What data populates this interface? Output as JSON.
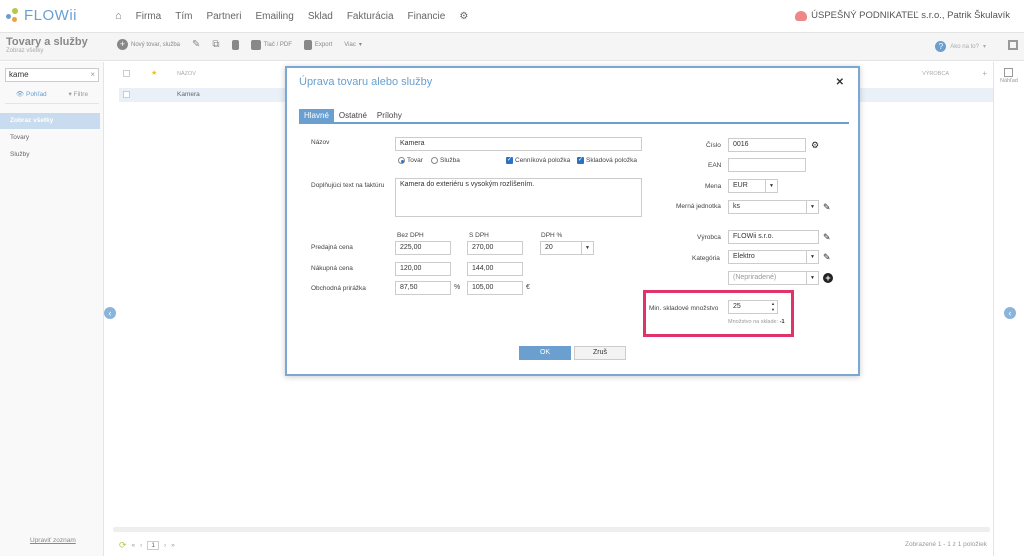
{
  "topnav": {
    "logo": "FLOWii",
    "items": [
      "Firma",
      "Tím",
      "Partneri",
      "Emailing",
      "Sklad",
      "Fakturácia",
      "Financie"
    ],
    "company": "ÚSPEŠNÝ PODNIKATEĽ s.r.o., Patrik Škulavík"
  },
  "subheader": {
    "title": "Tovary a služby",
    "subtitle": "Zobraz všetky",
    "toolbar": {
      "new": "Nový tovar, služba",
      "print": "Tlač / PDF",
      "export": "Export",
      "more": "Viac"
    },
    "help": "Ako na to?"
  },
  "sidebar": {
    "search_value": "kame",
    "tab_view": "Pohľad",
    "tab_filter": "Filtre",
    "items": [
      "Zobraz všetky",
      "Tovary",
      "Služby"
    ],
    "footer": "Upraviť zoznam"
  },
  "list": {
    "col_name": "NÁZOV",
    "col_vyrobca": "VÝROBCA",
    "rows": [
      "Kamera"
    ]
  },
  "right_strip": {
    "label": "Náhľad"
  },
  "footer": {
    "page": "1",
    "info": "Zobrazené 1 - 1 z 1 položiek"
  },
  "dialog": {
    "title": "Úprava tovaru alebo služby",
    "tabs": [
      "Hlavné",
      "Ostatné",
      "Prílohy"
    ],
    "labels": {
      "nazov": "Názov",
      "doplnujuci": "Doplňujúci text na faktúru",
      "bez_dph": "Bez DPH",
      "s_dph": "S DPH",
      "dph_pct": "DPH %",
      "predajna": "Predajná cena",
      "nakupna": "Nákupná cena",
      "prirazka": "Obchodná prirážka",
      "cislo": "Číslo",
      "ean": "EAN",
      "mena": "Mena",
      "merna": "Merná jednotka",
      "vyrobca": "Výrobca",
      "kategoria": "Kategória",
      "min_sklad": "Min. skladové množstvo",
      "mnozstvo_note": "Množstvo na sklade: ",
      "mnozstvo_value": "-1"
    },
    "values": {
      "nazov": "Kamera",
      "doplnujuci": "Kamera do exteriéru s vysokým rozlíšením.",
      "predajna_bez": "225,00",
      "predajna_s": "270,00",
      "dph": "20",
      "nakupna_bez": "120,00",
      "nakupna_s": "144,00",
      "prirazka_pct": "87,50",
      "prirazka_eur": "105,00",
      "cislo": "0016",
      "ean": "",
      "mena": "EUR",
      "merna": "ks",
      "vyrobca": "FLOWii s.r.o.",
      "kategoria": "Elektro",
      "subkategoria": "(Nepriradené)",
      "min_sklad": "25"
    },
    "radios": {
      "tovar": "Tovar",
      "sluzba": "Služba"
    },
    "checks": {
      "cennikova": "Cenníková položka",
      "skladova": "Skladová položka"
    },
    "units": {
      "pct": "%",
      "eur": "€"
    },
    "buttons": {
      "ok": "OK",
      "cancel": "Zruš"
    }
  }
}
